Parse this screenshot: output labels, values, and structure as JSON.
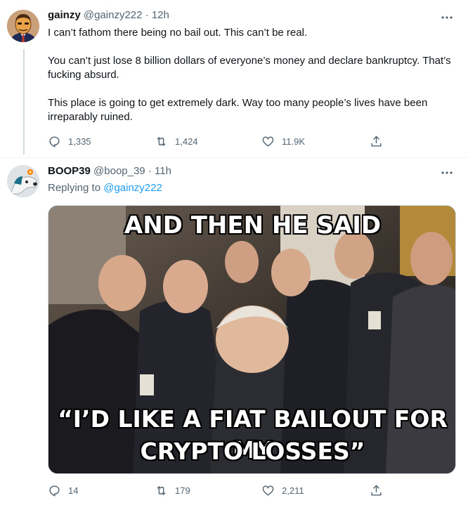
{
  "tweets": [
    {
      "author_name": "gainzy",
      "handle": "@gainzy222",
      "separator": "·",
      "time": "12h",
      "paragraphs": [
        "I can’t fathom there being no bail out. This can’t be real.",
        "You can’t just lose 8 billion dollars of everyone’s money and declare bankruptcy. That’s fucking absurd.",
        "This place is going to get extremely dark. Way too many people’s lives have been irreparably ruined."
      ],
      "stats": {
        "replies": "1,335",
        "retweets": "1,424",
        "likes": "11.9K"
      }
    },
    {
      "author_name": "BOOP39",
      "handle": "@boop_39",
      "separator": "·",
      "time": "11h",
      "replying_label": "Replying to",
      "replying_handle": "@gainzy222",
      "meme": {
        "top_text": "AND THEN HE SAID",
        "bottom_text_1": "“I’D LIKE A FIAT BAILOUT FOR MY",
        "bottom_text_2": "CRYPTO LOSSES”"
      },
      "stats": {
        "replies": "14",
        "retweets": "179",
        "likes": "2,211"
      }
    }
  ],
  "icons": {
    "more": "more-horizontal-icon",
    "reply": "reply-bubble-icon",
    "retweet": "retweet-arrows-icon",
    "like": "heart-outline-icon",
    "share": "share-upload-icon"
  },
  "colors": {
    "text": "#0f1419",
    "muted": "#536471",
    "link": "#1d9bf0",
    "divider": "#eff3f4",
    "thread_line": "#cfd9de"
  }
}
